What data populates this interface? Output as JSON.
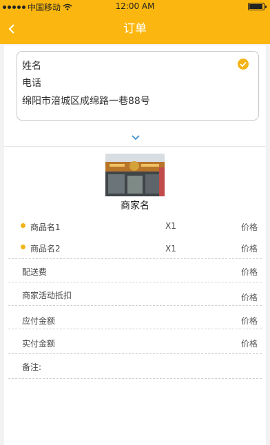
{
  "status_bar": {
    "carrier": "中国移动",
    "time": "12:00 AM"
  },
  "header": {
    "title": "订单",
    "back_icon": "chevron-left-icon"
  },
  "address": {
    "name": "姓名",
    "phone": "电话",
    "address": "绵阳市涪城区成绵路一巷88号",
    "selected_icon": "check-circle-icon"
  },
  "expand_icon": "chevron-down-icon",
  "merchant": {
    "name": "商家名"
  },
  "items": [
    {
      "name": "商品名1",
      "qty": "X1",
      "price": "价格"
    },
    {
      "name": "商品名2",
      "qty": "X1",
      "price": "价格"
    }
  ],
  "fees": {
    "delivery_label": "配送费",
    "delivery_value": "价格",
    "discount_label": "商家活动抵扣",
    "discount_value": "价格",
    "payable_label": "应付金额",
    "payable_value": "价格",
    "paid_label": "实付金额",
    "paid_value": "价格",
    "note_label": "备注:"
  },
  "colors": {
    "accent": "#fbb70f",
    "bullet": "#f2b41b",
    "expand_arrow": "#3c8fd6"
  }
}
